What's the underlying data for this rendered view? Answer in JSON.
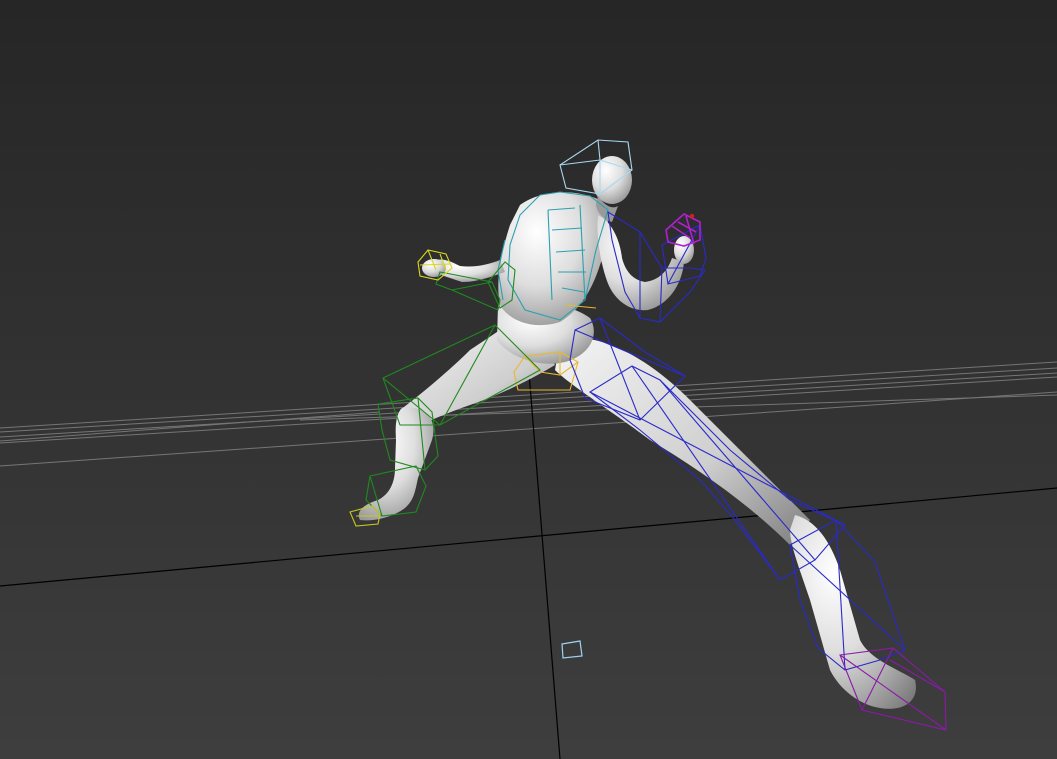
{
  "viewport": {
    "view": "perspective",
    "shading": "default-shading",
    "colors": {
      "background_top": "#262626",
      "background_bottom": "#3c3c3c",
      "grid": "#8a8a8a",
      "axis": "#000000",
      "mesh_light": "#f2f2f2",
      "mesh_dark": "#6e6e6e",
      "biped_left": "#1f8a1f",
      "biped_right": "#2a2ac8",
      "biped_spine": "#2aa0b0",
      "biped_head": "#a8d8f0",
      "biped_pelvis": "#e8b830",
      "biped_hand_left": "#d8d820",
      "biped_hand_right": "#a020c0",
      "biped_foot_right": "#8a1aa8",
      "com_marker": "#9fd4f0"
    }
  },
  "scene": {
    "mesh": "mannequin-mesh",
    "rig": "biped-rig",
    "pose": "lunge"
  }
}
